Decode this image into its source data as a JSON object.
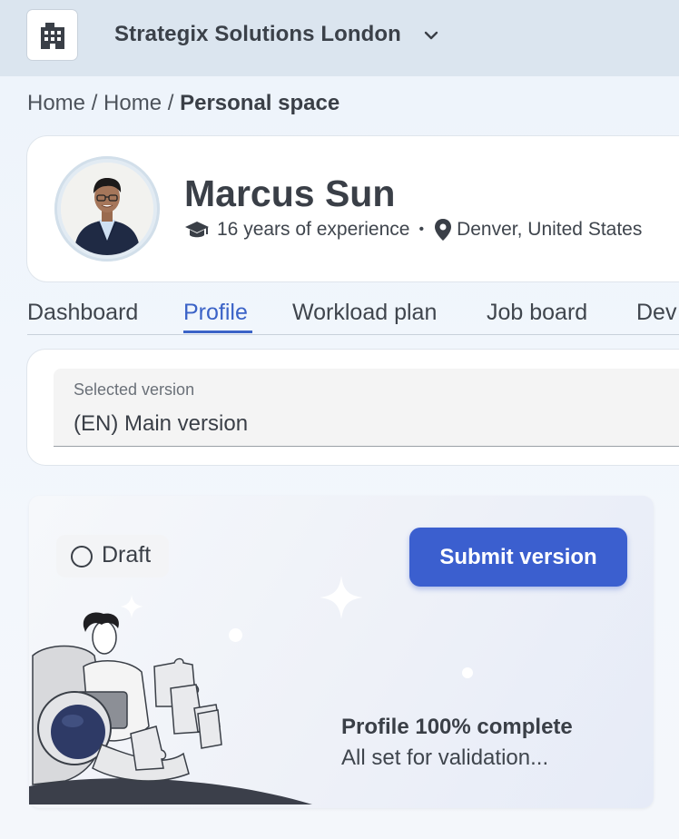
{
  "header": {
    "org_name": "Strategix Solutions London",
    "org_logo_icon": "building-icon",
    "chevron_icon": "chevron-down-icon"
  },
  "breadcrumb": {
    "items": [
      "Home",
      "Home"
    ],
    "separator": "/",
    "current": "Personal space"
  },
  "profile": {
    "name": "Marcus Sun",
    "experience": "16 years of experience",
    "experience_icon": "graduation-cap-icon",
    "location": "Denver, United States",
    "location_icon": "map-pin-icon",
    "meta_separator": "•"
  },
  "tabs": [
    {
      "label": "Dashboard",
      "active": false
    },
    {
      "label": "Profile",
      "active": true
    },
    {
      "label": "Workload plan",
      "active": false
    },
    {
      "label": "Job board",
      "active": false
    },
    {
      "label": "Dev",
      "active": false
    }
  ],
  "version_select": {
    "label": "Selected version",
    "value": "(EN) Main version"
  },
  "status_card": {
    "status_label": "Draft",
    "submit_label": "Submit version",
    "complete_title": "Profile 100% complete",
    "complete_subtitle": "All set for validation...",
    "profile_completion_percent": 100
  },
  "colors": {
    "accent": "#3b5fcf",
    "topbar": "#dbe5ef",
    "text": "#3a3f47"
  }
}
